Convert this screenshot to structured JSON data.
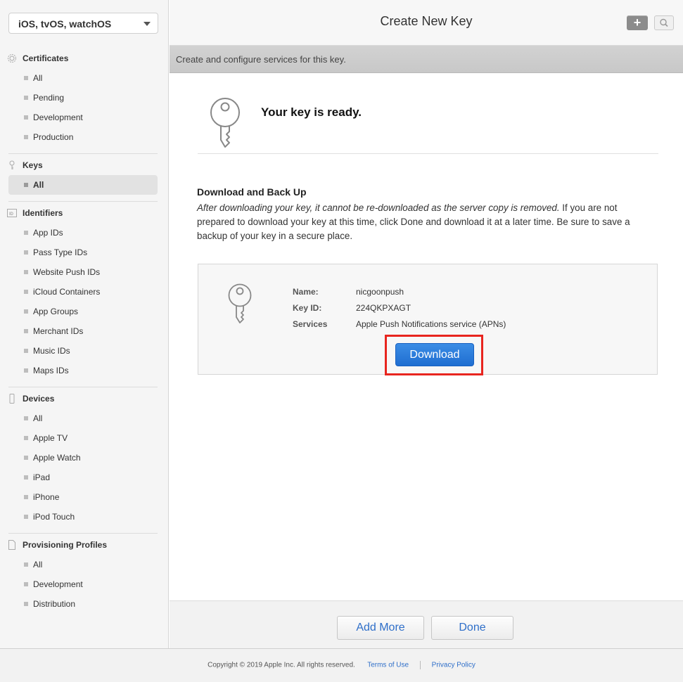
{
  "sidebar": {
    "platform": "iOS, tvOS, watchOS",
    "certificates": {
      "title": "Certificates",
      "items": [
        "All",
        "Pending",
        "Development",
        "Production"
      ]
    },
    "keys": {
      "title": "Keys",
      "items": [
        "All"
      ]
    },
    "identifiers": {
      "title": "Identifiers",
      "items": [
        "App IDs",
        "Pass Type IDs",
        "Website Push IDs",
        "iCloud Containers",
        "App Groups",
        "Merchant IDs",
        "Music IDs",
        "Maps IDs"
      ]
    },
    "devices": {
      "title": "Devices",
      "items": [
        "All",
        "Apple TV",
        "Apple Watch",
        "iPad",
        "iPhone",
        "iPod Touch"
      ]
    },
    "profiles": {
      "title": "Provisioning Profiles",
      "items": [
        "All",
        "Development",
        "Distribution"
      ]
    }
  },
  "header": {
    "title": "Create New Key",
    "add_label": "+",
    "subtitle": "Create and configure services for this key."
  },
  "main": {
    "ready_title": "Your key is ready.",
    "backup_title": "Download and Back Up",
    "backup_italic": "After downloading your key, it cannot be re-downloaded as the server copy is removed.",
    "backup_rest": " If you are not prepared to download your key at this time, click Done and download it at a later time. Be sure to save a backup of your key in a secure place.",
    "key": {
      "name_label": "Name:",
      "name_value": "nicgoonpush",
      "id_label": "Key ID:",
      "id_value": "224QKPXAGT",
      "services_label": "Services",
      "services_value": "Apple Push Notifications service (APNs)"
    },
    "download_label": "Download"
  },
  "footer": {
    "add_more_label": "Add More",
    "done_label": "Done"
  },
  "page_footer": {
    "copyright": "Copyright © 2019 Apple Inc. All rights reserved.",
    "terms": "Terms of Use",
    "privacy": "Privacy Policy"
  },
  "colors": {
    "accent": "#2f6fc9",
    "download_button": "#1f6ed1",
    "highlight_box": "#e8251f"
  }
}
